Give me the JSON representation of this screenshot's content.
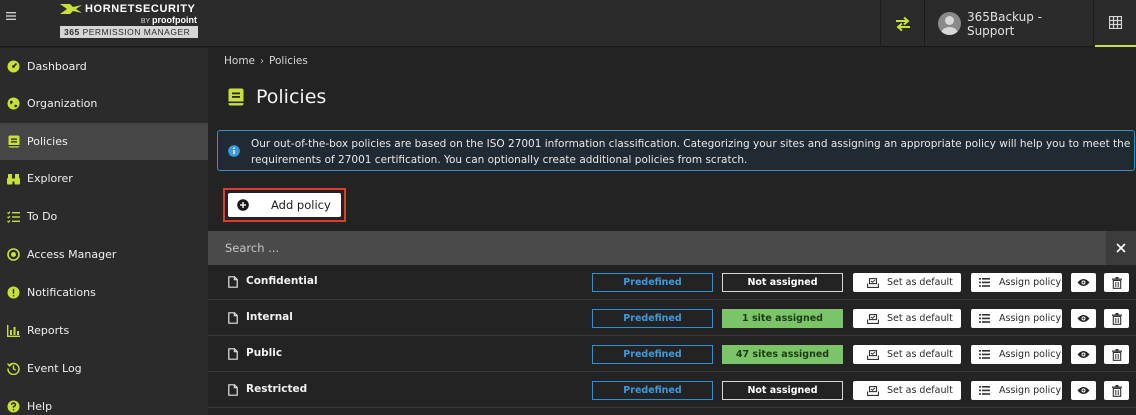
{
  "header": {
    "menu_icon": "hamburger-icon",
    "brand_name": "HORNETSECURITY",
    "brand_by": "BY",
    "brand_parent": "proofpoint",
    "product_prefix": "365",
    "product_name": "PERMISSION MANAGER",
    "swap_icon": "swap-arrows-icon",
    "user_name": "365Backup - Support",
    "apps_icon": "grid-icon",
    "accent_color": "#c8e03a"
  },
  "sidebar": {
    "items": [
      {
        "label": "Dashboard",
        "icon": "dashboard-icon",
        "active": false
      },
      {
        "label": "Organization",
        "icon": "globe-icon",
        "active": false
      },
      {
        "label": "Policies",
        "icon": "policy-book-icon",
        "active": true
      },
      {
        "label": "Explorer",
        "icon": "binoculars-icon",
        "active": false
      },
      {
        "label": "To Do",
        "icon": "checklist-icon",
        "active": false
      },
      {
        "label": "Access Manager",
        "icon": "target-icon",
        "active": false
      },
      {
        "label": "Notifications",
        "icon": "alert-icon",
        "active": false
      },
      {
        "label": "Reports",
        "icon": "bar-chart-icon",
        "active": false
      },
      {
        "label": "Event Log",
        "icon": "history-icon",
        "active": false
      },
      {
        "label": "Help",
        "icon": "help-icon",
        "active": false
      }
    ]
  },
  "breadcrumb": {
    "home": "Home",
    "separator": "›",
    "current": "Policies"
  },
  "page": {
    "title": "Policies"
  },
  "info": {
    "text": "Our out-of-the-box policies are based on the ISO 27001 information classification. Categorizing your sites and assigning an appropriate policy will help you to meet the requirements of 27001 certification. You can optionally create additional policies from scratch."
  },
  "toolbar": {
    "add_label": "Add policy"
  },
  "search": {
    "placeholder": "Search ..."
  },
  "policies": [
    {
      "name": "Confidential",
      "type": "Predefined",
      "assignment": "Not assigned",
      "assigned": false,
      "set_default": "Set as default",
      "assign": "Assign policy"
    },
    {
      "name": "Internal",
      "type": "Predefined",
      "assignment": "1 site assigned",
      "assigned": true,
      "set_default": "Set as default",
      "assign": "Assign policy"
    },
    {
      "name": "Public",
      "type": "Predefined",
      "assignment": "47 sites assigned",
      "assigned": true,
      "set_default": "Set as default",
      "assign": "Assign policy"
    },
    {
      "name": "Restricted",
      "type": "Predefined",
      "assignment": "Not assigned",
      "assigned": false,
      "set_default": "Set as default",
      "assign": "Assign policy"
    }
  ]
}
